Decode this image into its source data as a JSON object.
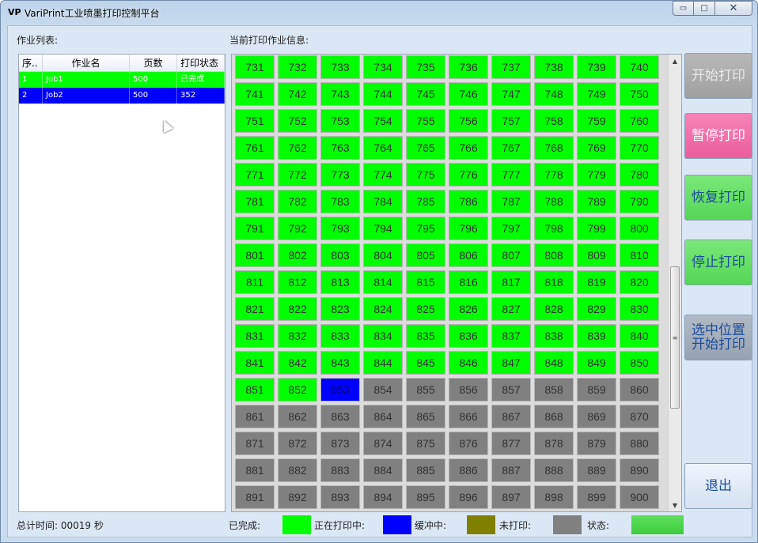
{
  "window": {
    "title": "VariPrint工业喷墨打印控制平台",
    "icon_text": "VP",
    "controls": {
      "minimize": "▭",
      "maximize": "□",
      "close": "✕"
    }
  },
  "jobs_panel": {
    "label": "作业列表:",
    "columns": [
      "序..",
      "作业名",
      "页数",
      "打印状态"
    ],
    "rows": [
      {
        "index": "1",
        "name": "Job1",
        "pages": "500",
        "status": "已完成",
        "color": "#00ff00"
      },
      {
        "index": "2",
        "name": "Job2",
        "pages": "500",
        "status": "352",
        "color": "#0000ff"
      }
    ]
  },
  "print_info": {
    "label": "当前打印作业信息:",
    "cells": [
      {
        "n": "731",
        "s": "done"
      },
      {
        "n": "732",
        "s": "done"
      },
      {
        "n": "733",
        "s": "done"
      },
      {
        "n": "734",
        "s": "done"
      },
      {
        "n": "735",
        "s": "done"
      },
      {
        "n": "736",
        "s": "done"
      },
      {
        "n": "737",
        "s": "done"
      },
      {
        "n": "738",
        "s": "done"
      },
      {
        "n": "739",
        "s": "done"
      },
      {
        "n": "740",
        "s": "done"
      },
      {
        "n": "741",
        "s": "done"
      },
      {
        "n": "742",
        "s": "done"
      },
      {
        "n": "743",
        "s": "done"
      },
      {
        "n": "744",
        "s": "done"
      },
      {
        "n": "745",
        "s": "done"
      },
      {
        "n": "746",
        "s": "done"
      },
      {
        "n": "747",
        "s": "done"
      },
      {
        "n": "748",
        "s": "done"
      },
      {
        "n": "749",
        "s": "done"
      },
      {
        "n": "750",
        "s": "done"
      },
      {
        "n": "751",
        "s": "done"
      },
      {
        "n": "752",
        "s": "done"
      },
      {
        "n": "753",
        "s": "done"
      },
      {
        "n": "754",
        "s": "done"
      },
      {
        "n": "755",
        "s": "done"
      },
      {
        "n": "756",
        "s": "done"
      },
      {
        "n": "757",
        "s": "done"
      },
      {
        "n": "758",
        "s": "done"
      },
      {
        "n": "759",
        "s": "done"
      },
      {
        "n": "760",
        "s": "done"
      },
      {
        "n": "761",
        "s": "done"
      },
      {
        "n": "762",
        "s": "done"
      },
      {
        "n": "763",
        "s": "done"
      },
      {
        "n": "764",
        "s": "done"
      },
      {
        "n": "765",
        "s": "done"
      },
      {
        "n": "766",
        "s": "done"
      },
      {
        "n": "767",
        "s": "done"
      },
      {
        "n": "768",
        "s": "done"
      },
      {
        "n": "769",
        "s": "done"
      },
      {
        "n": "770",
        "s": "done"
      },
      {
        "n": "771",
        "s": "done"
      },
      {
        "n": "772",
        "s": "done"
      },
      {
        "n": "773",
        "s": "done"
      },
      {
        "n": "774",
        "s": "done"
      },
      {
        "n": "775",
        "s": "done"
      },
      {
        "n": "776",
        "s": "done"
      },
      {
        "n": "777",
        "s": "done"
      },
      {
        "n": "778",
        "s": "done"
      },
      {
        "n": "779",
        "s": "done"
      },
      {
        "n": "780",
        "s": "done"
      },
      {
        "n": "781",
        "s": "done"
      },
      {
        "n": "782",
        "s": "done"
      },
      {
        "n": "783",
        "s": "done"
      },
      {
        "n": "784",
        "s": "done"
      },
      {
        "n": "785",
        "s": "done"
      },
      {
        "n": "786",
        "s": "done"
      },
      {
        "n": "787",
        "s": "done"
      },
      {
        "n": "788",
        "s": "done"
      },
      {
        "n": "789",
        "s": "done"
      },
      {
        "n": "790",
        "s": "done"
      },
      {
        "n": "791",
        "s": "done"
      },
      {
        "n": "792",
        "s": "done"
      },
      {
        "n": "793",
        "s": "done"
      },
      {
        "n": "794",
        "s": "done"
      },
      {
        "n": "795",
        "s": "done"
      },
      {
        "n": "796",
        "s": "done"
      },
      {
        "n": "797",
        "s": "done"
      },
      {
        "n": "798",
        "s": "done"
      },
      {
        "n": "799",
        "s": "done"
      },
      {
        "n": "800",
        "s": "done"
      },
      {
        "n": "801",
        "s": "done"
      },
      {
        "n": "802",
        "s": "done"
      },
      {
        "n": "803",
        "s": "done"
      },
      {
        "n": "804",
        "s": "done"
      },
      {
        "n": "805",
        "s": "done"
      },
      {
        "n": "806",
        "s": "done"
      },
      {
        "n": "807",
        "s": "done"
      },
      {
        "n": "808",
        "s": "done"
      },
      {
        "n": "809",
        "s": "done"
      },
      {
        "n": "810",
        "s": "done"
      },
      {
        "n": "811",
        "s": "done"
      },
      {
        "n": "812",
        "s": "done"
      },
      {
        "n": "813",
        "s": "done"
      },
      {
        "n": "814",
        "s": "done"
      },
      {
        "n": "815",
        "s": "done"
      },
      {
        "n": "816",
        "s": "done"
      },
      {
        "n": "817",
        "s": "done"
      },
      {
        "n": "818",
        "s": "done"
      },
      {
        "n": "819",
        "s": "done"
      },
      {
        "n": "820",
        "s": "done"
      },
      {
        "n": "821",
        "s": "done"
      },
      {
        "n": "822",
        "s": "done"
      },
      {
        "n": "823",
        "s": "done"
      },
      {
        "n": "824",
        "s": "done"
      },
      {
        "n": "825",
        "s": "done"
      },
      {
        "n": "826",
        "s": "done"
      },
      {
        "n": "827",
        "s": "done"
      },
      {
        "n": "828",
        "s": "done"
      },
      {
        "n": "829",
        "s": "done"
      },
      {
        "n": "830",
        "s": "done"
      },
      {
        "n": "831",
        "s": "done"
      },
      {
        "n": "832",
        "s": "done"
      },
      {
        "n": "833",
        "s": "done"
      },
      {
        "n": "834",
        "s": "done"
      },
      {
        "n": "835",
        "s": "done"
      },
      {
        "n": "836",
        "s": "done"
      },
      {
        "n": "837",
        "s": "done"
      },
      {
        "n": "838",
        "s": "done"
      },
      {
        "n": "839",
        "s": "done"
      },
      {
        "n": "840",
        "s": "done"
      },
      {
        "n": "841",
        "s": "done"
      },
      {
        "n": "842",
        "s": "done"
      },
      {
        "n": "843",
        "s": "done"
      },
      {
        "n": "844",
        "s": "done"
      },
      {
        "n": "845",
        "s": "done"
      },
      {
        "n": "846",
        "s": "done"
      },
      {
        "n": "847",
        "s": "done"
      },
      {
        "n": "848",
        "s": "done"
      },
      {
        "n": "849",
        "s": "done"
      },
      {
        "n": "850",
        "s": "done"
      },
      {
        "n": "851",
        "s": "done"
      },
      {
        "n": "852",
        "s": "done"
      },
      {
        "n": "853",
        "s": "printing"
      },
      {
        "n": "854",
        "s": "status"
      },
      {
        "n": "855",
        "s": "status"
      },
      {
        "n": "856",
        "s": "status"
      },
      {
        "n": "857",
        "s": "status"
      },
      {
        "n": "858",
        "s": "status"
      },
      {
        "n": "859",
        "s": "status"
      },
      {
        "n": "860",
        "s": "status"
      },
      {
        "n": "861",
        "s": "status"
      },
      {
        "n": "862",
        "s": "status"
      },
      {
        "n": "863",
        "s": "status"
      },
      {
        "n": "864",
        "s": "status"
      },
      {
        "n": "865",
        "s": "status"
      },
      {
        "n": "866",
        "s": "status"
      },
      {
        "n": "867",
        "s": "status"
      },
      {
        "n": "868",
        "s": "status"
      },
      {
        "n": "869",
        "s": "status"
      },
      {
        "n": "870",
        "s": "status"
      },
      {
        "n": "871",
        "s": "status"
      },
      {
        "n": "872",
        "s": "status"
      },
      {
        "n": "873",
        "s": "status"
      },
      {
        "n": "874",
        "s": "status"
      },
      {
        "n": "875",
        "s": "status"
      },
      {
        "n": "876",
        "s": "status"
      },
      {
        "n": "877",
        "s": "status"
      },
      {
        "n": "878",
        "s": "status"
      },
      {
        "n": "879",
        "s": "status"
      },
      {
        "n": "880",
        "s": "status"
      },
      {
        "n": "881",
        "s": "status"
      },
      {
        "n": "882",
        "s": "status"
      },
      {
        "n": "883",
        "s": "status"
      },
      {
        "n": "884",
        "s": "status"
      },
      {
        "n": "885",
        "s": "status"
      },
      {
        "n": "886",
        "s": "status"
      },
      {
        "n": "887",
        "s": "status"
      },
      {
        "n": "888",
        "s": "status"
      },
      {
        "n": "889",
        "s": "status"
      },
      {
        "n": "890",
        "s": "status"
      },
      {
        "n": "891",
        "s": "status"
      },
      {
        "n": "892",
        "s": "status"
      },
      {
        "n": "893",
        "s": "status"
      },
      {
        "n": "894",
        "s": "status"
      },
      {
        "n": "895",
        "s": "status"
      },
      {
        "n": "896",
        "s": "status"
      },
      {
        "n": "897",
        "s": "status"
      },
      {
        "n": "898",
        "s": "status"
      },
      {
        "n": "899",
        "s": "status"
      },
      {
        "n": "900",
        "s": "status"
      }
    ]
  },
  "buttons": {
    "start": "开始打印",
    "pause": "暂停打印",
    "resume": "恢复打印",
    "stop": "停止打印",
    "start_from_selected": "选中位置\n开始打印",
    "exit": "退出"
  },
  "footer": {
    "total_time": "总计时间: 00019 秒",
    "legend": {
      "done": "已完成:",
      "printing": "正在打印中:",
      "buffering": "缓冲中:",
      "not_printed": "未打印:",
      "status": "状态:"
    }
  },
  "colors": {
    "done": "#00ff00",
    "printing": "#0000ff",
    "buffering": "#808000",
    "status": "#808080",
    "status_indicator": "#44dd44",
    "btn_disabled": "#a8a8a8",
    "btn_pause": "#f06fa8",
    "btn_active": "#6be06b",
    "btn_selected": "#a0aab8",
    "btn_exit": "#dce8f6"
  }
}
